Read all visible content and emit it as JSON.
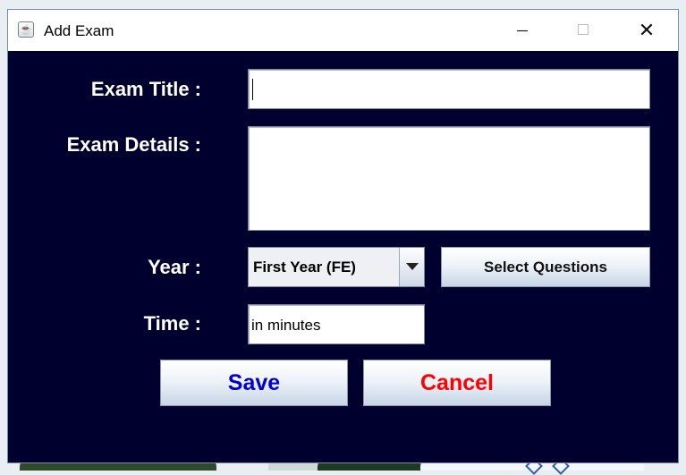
{
  "window": {
    "title": "Add Exam",
    "close_glyph": "✕"
  },
  "icons": {
    "app": "java-coffee-icon",
    "minimize": "minimize-icon",
    "maximize": "maximize-icon",
    "close": "close-icon",
    "dropdown": "chevron-down-icon"
  },
  "form": {
    "exam_title_label": "Exam Title :",
    "exam_title_value": "",
    "exam_details_label": "Exam Details :",
    "exam_details_value": "",
    "year_label": "Year :",
    "year_selected": "First Year (FE)",
    "select_questions_label": "Select Questions",
    "time_label": "Time :",
    "time_value": "in minutes"
  },
  "actions": {
    "save_label": "Save",
    "cancel_label": "Cancel"
  },
  "colors": {
    "panel_background": "#00002e",
    "save_text": "#0000d6",
    "cancel_text": "#ff0000"
  }
}
